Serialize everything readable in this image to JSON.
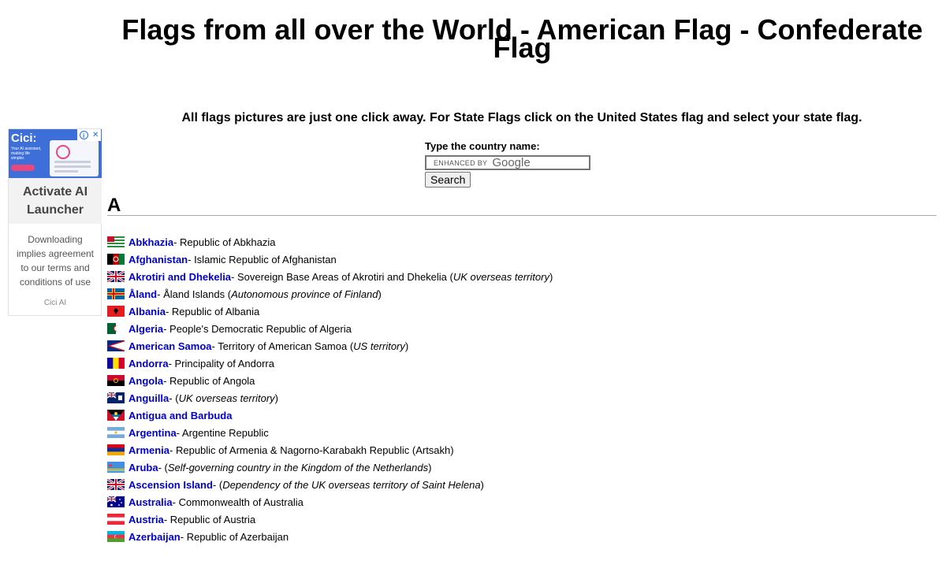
{
  "page": {
    "title_line1": "Flags from all over the World - American Flag - Confederate",
    "title_line2": "Flag",
    "intro": "All flags pictures are just one click away. For State Flags click on the United States flag and select your state flag."
  },
  "search": {
    "label": "Type the country name:",
    "enhanced_by": "ENHANCED BY",
    "google": "Google",
    "button_label": "Search"
  },
  "section": {
    "letter": "A"
  },
  "countries": [
    {
      "name": "Abkhazia",
      "desc": " - Republic of Abkhazia",
      "note": "",
      "flag": "abkhazia-flag-icon"
    },
    {
      "name": "Afghanistan",
      "desc": " - Islamic Republic of Afghanistan",
      "note": "",
      "flag": "afghanistan-flag-icon"
    },
    {
      "name": "Akrotiri and Dhekelia",
      "desc": " - Sovereign Base Areas of Akrotiri and Dhekelia (",
      "note": "UK overseas territory",
      "flag": "uk-flag-icon"
    },
    {
      "name": "Åland",
      "desc": " - Åland Islands (",
      "note": "Autonomous province of Finland",
      "flag": "aland-flag-icon"
    },
    {
      "name": "Albania",
      "desc": " - Republic of Albania",
      "note": "",
      "flag": "albania-flag-icon"
    },
    {
      "name": "Algeria",
      "desc": " - People's Democratic Republic of Algeria",
      "note": "",
      "flag": "algeria-flag-icon"
    },
    {
      "name": "American Samoa",
      "desc": " - Territory of American Samoa (",
      "note": "US territory",
      "flag": "american-samoa-flag-icon"
    },
    {
      "name": "Andorra",
      "desc": " - Principality of Andorra",
      "note": "",
      "flag": "andorra-flag-icon"
    },
    {
      "name": "Angola",
      "desc": " - Republic of Angola",
      "note": "",
      "flag": "angola-flag-icon"
    },
    {
      "name": "Anguilla",
      "desc": " - (",
      "note": "UK overseas territory",
      "flag": "anguilla-flag-icon"
    },
    {
      "name": "Antigua and Barbuda",
      "desc": "",
      "note": "",
      "flag": "antigua-flag-icon"
    },
    {
      "name": "Argentina",
      "desc": " - Argentine Republic",
      "note": "",
      "flag": "argentina-flag-icon"
    },
    {
      "name": "Armenia",
      "desc": " - Republic of Armenia & Nagorno-Karabakh Republic (Artsakh)",
      "note": "",
      "flag": "armenia-flag-icon"
    },
    {
      "name": "Aruba",
      "desc": " - (",
      "note": "Self-governing country in the Kingdom of the Netherlands",
      "flag": "aruba-flag-icon"
    },
    {
      "name": "Ascension Island",
      "desc": " - (",
      "note": "Dependency of the UK overseas territory of Saint Helena",
      "flag": "uk-flag-icon"
    },
    {
      "name": "Australia",
      "desc": " - Commonwealth of Australia",
      "note": "",
      "flag": "australia-flag-icon"
    },
    {
      "name": "Austria",
      "desc": " - Republic of Austria",
      "note": "",
      "flag": "austria-flag-icon"
    },
    {
      "name": "Azerbaijan",
      "desc": " - Republic of Azerbaijan",
      "note": "",
      "flag": "azerbaijan-flag-icon"
    }
  ],
  "ad": {
    "brand_logo": "Cici:",
    "tagline": "Your AI assistant, making life simpler.",
    "title": "Activate AI Launcher",
    "body": "Downloading implies agreement to our terms and conditions of use",
    "brand": "Cici AI",
    "info_icon": "info-icon",
    "close_icon": "close-icon"
  },
  "colors": {
    "link": "#0000cc",
    "rule": "#aaaaaa",
    "ad_blue": "#3e6fd8"
  }
}
